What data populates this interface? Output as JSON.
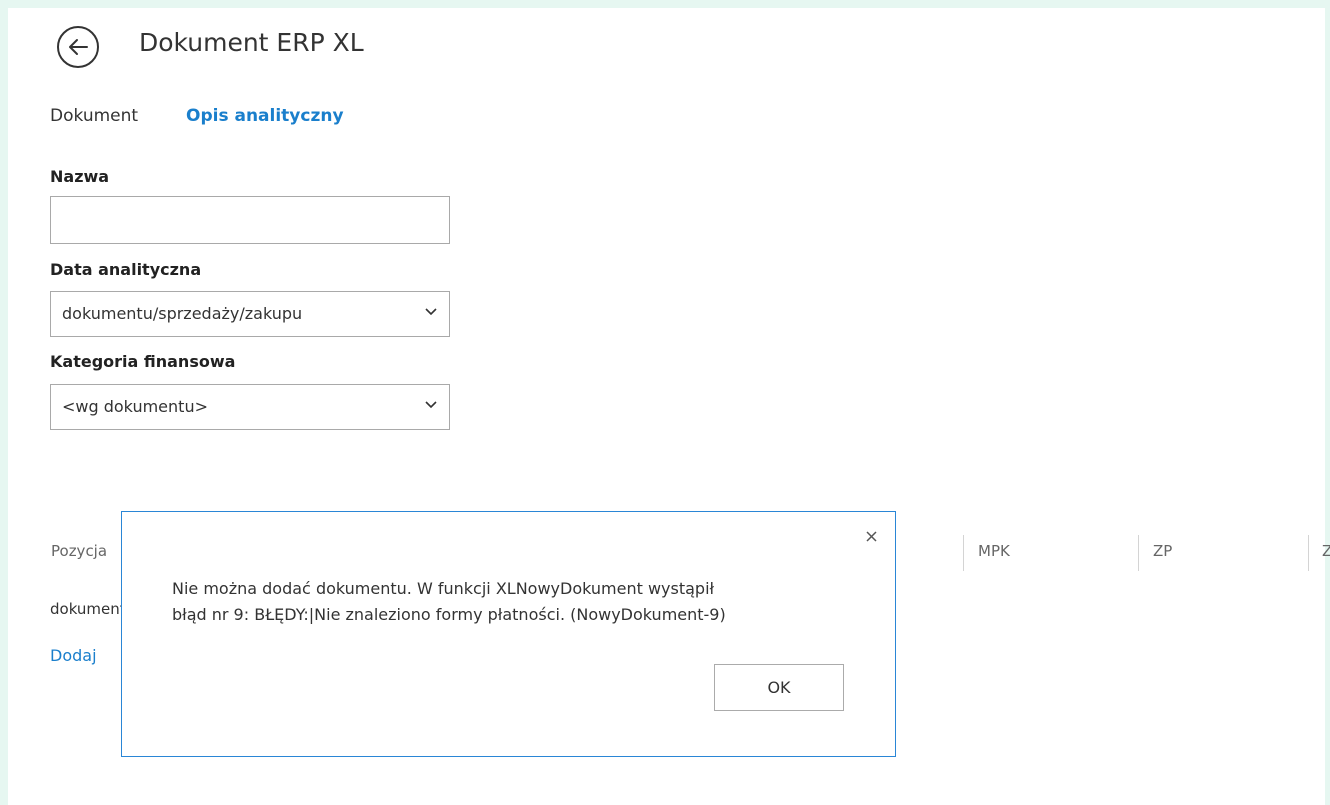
{
  "header": {
    "title": "Dokument ERP XL",
    "back_icon": "arrow-left-icon"
  },
  "tabs": [
    {
      "label": "Dokument",
      "active": false
    },
    {
      "label": "Opis analityczny",
      "active": true
    }
  ],
  "form": {
    "nazwa_label": "Nazwa",
    "nazwa_value": "",
    "data_label": "Data analityczna",
    "data_value": "dokumentu/sprzedaży/zakupu",
    "kategoria_label": "Kategoria finansowa",
    "kategoria_value": "<wg dokumentu>"
  },
  "table": {
    "columns": [
      "Pozycja",
      "MPK",
      "ZP",
      "Z"
    ],
    "row_first_cell": "dokumentu",
    "add_label": "Dodaj"
  },
  "dialog": {
    "message_line1": "Nie można dodać dokumentu. W funkcji XLNowyDokument wystąpił",
    "message_line2": "błąd nr 9: BŁĘDY:|Nie znaleziono formy płatności. (NowyDokument-9)",
    "ok_label": "OK",
    "close_icon": "close-icon"
  },
  "colors": {
    "accent": "#1a7fcc",
    "dialog_border": "#2a86d6",
    "outer_background": "#e6f7f1"
  }
}
